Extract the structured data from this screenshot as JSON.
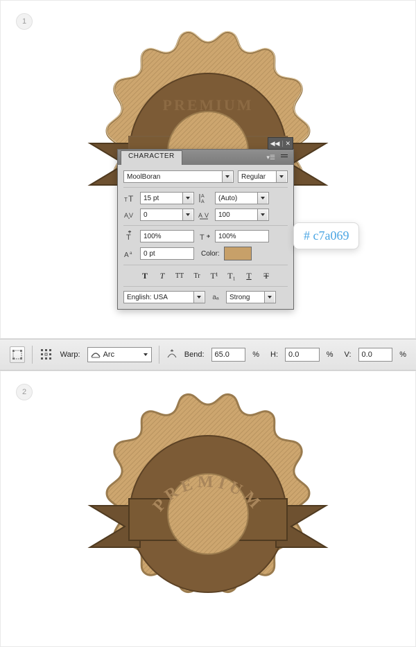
{
  "steps": {
    "one": "1",
    "two": "2"
  },
  "badge_text": "PREMIUM",
  "char_panel": {
    "tab": "CHARACTER",
    "font_family": "MoolBoran",
    "font_style": "Regular",
    "size": "15 pt",
    "leading": "(Auto)",
    "kerning": "0",
    "tracking": "100",
    "vscale": "100%",
    "hscale": "100%",
    "baseline": "0 pt",
    "color_label": "Color:",
    "styles": {
      "bold": "T",
      "faux": "T",
      "caps": "TT",
      "small": "Tr",
      "sup": "T¹",
      "sub": "T₁",
      "underline": "T",
      "strike": "T"
    },
    "language": "English: USA",
    "aa_label": "aₐ",
    "aa_value": "Strong"
  },
  "hex_label": "# c7a069",
  "swatch_color": "#c7a069",
  "warp": {
    "label": "Warp:",
    "style": "Arc",
    "bend_label": "Bend:",
    "bend_value": "65.0",
    "h_label": "H:",
    "h_value": "0.0",
    "v_label": "V:",
    "v_value": "0.0",
    "pct": "%"
  }
}
